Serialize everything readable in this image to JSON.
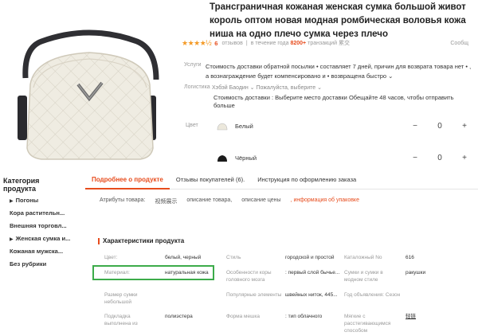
{
  "product": {
    "title_line1": "Трансграничная кожаная женская сумка большой живот",
    "title_line2": "король оптом            новая модная ромбическая воловья кожа",
    "title_line3": "ниша на одно плечо сумка через плечо"
  },
  "rating": {
    "stars": "★★★★½",
    "score": "6",
    "reviews_label": "отзывов",
    "year_label": "в течение года",
    "sales": "8200+",
    "sales_label": "транзакций 累交",
    "collect": "Сообщ"
  },
  "services": {
    "label": "Услуги",
    "text": "Стоимость доставки обратной посылки • составляет 7 дней, причин для возврата товара нет • , а вознаграждение будет компенсировано и • возвращена быстро ⌄"
  },
  "logistics": {
    "label": "Логистика",
    "text": "Хэбэй Баодин ⌄ Пожалуйста, выберите ⌄",
    "delivery": "Стоимость доставки : Выберите место доставки   Обещайте 48 часов, чтобы отправить больше"
  },
  "color": {
    "label": "Цвет",
    "options": [
      {
        "name": "Белый",
        "qty": "0",
        "minus": "−",
        "plus": "+"
      },
      {
        "name": "Чёрный",
        "qty": "0",
        "minus": "−",
        "plus": "+"
      }
    ]
  },
  "categories": {
    "title": "Категория продукта",
    "items": [
      {
        "label": "Погоны",
        "arrow": "▶"
      },
      {
        "label": "Кора растительн...",
        "arrow": ""
      },
      {
        "label": "Внешняя торговл...",
        "arrow": ""
      },
      {
        "label": "Женская сумка и...",
        "arrow": "▶"
      },
      {
        "label": "Кожаная мужска...",
        "arrow": ""
      },
      {
        "label": "Без рубрики",
        "arrow": ""
      }
    ]
  },
  "tabs": [
    {
      "label": "Подробнее о продукте",
      "active": true
    },
    {
      "label": "Отзывы покупателей (6).",
      "active": false
    },
    {
      "label": "Инструкция по оформлению заказа",
      "active": false
    }
  ],
  "subnav": {
    "label": "Атрибуты товара:",
    "item1": "视频展示",
    "item2": "описание товара,",
    "item3": "описание цены",
    "item4": ", информация об упаковке"
  },
  "attributes": {
    "title": "Характеристики продукта",
    "cells": [
      {
        "k": "Цвет:",
        "v": "белый, черный"
      },
      {
        "k": "Стиль",
        "v": "городской и простой"
      },
      {
        "k": "Каталожный No",
        "v": "616"
      },
      {
        "k": "Материал:",
        "v": "натуральная кожа"
      },
      {
        "k": "Особенности коры головного мозга",
        "v": ": первый слой бычье..."
      },
      {
        "k": "Сумки и сумки в модном стиле",
        "v": "ракушки"
      },
      {
        "k": "Размер сумки небольшой",
        "v": ""
      },
      {
        "k": "Популярные элементы",
        "v": "швейных ниток, 445..."
      },
      {
        "k": "Год объявления: Сезон",
        "v": ""
      },
      {
        "k": "Подкладка выполнена из",
        "v": "полиэстера"
      },
      {
        "k": "Форма мешка",
        "v": ": тип облачного"
      },
      {
        "k": "Мягкие с расстегивающимся способом",
        "v": "轻链"
      }
    ]
  },
  "colors": {
    "accent": "#e74c1d",
    "star": "#f49a26",
    "highlight": "#3cab4a",
    "bag": "#ece8dc"
  }
}
